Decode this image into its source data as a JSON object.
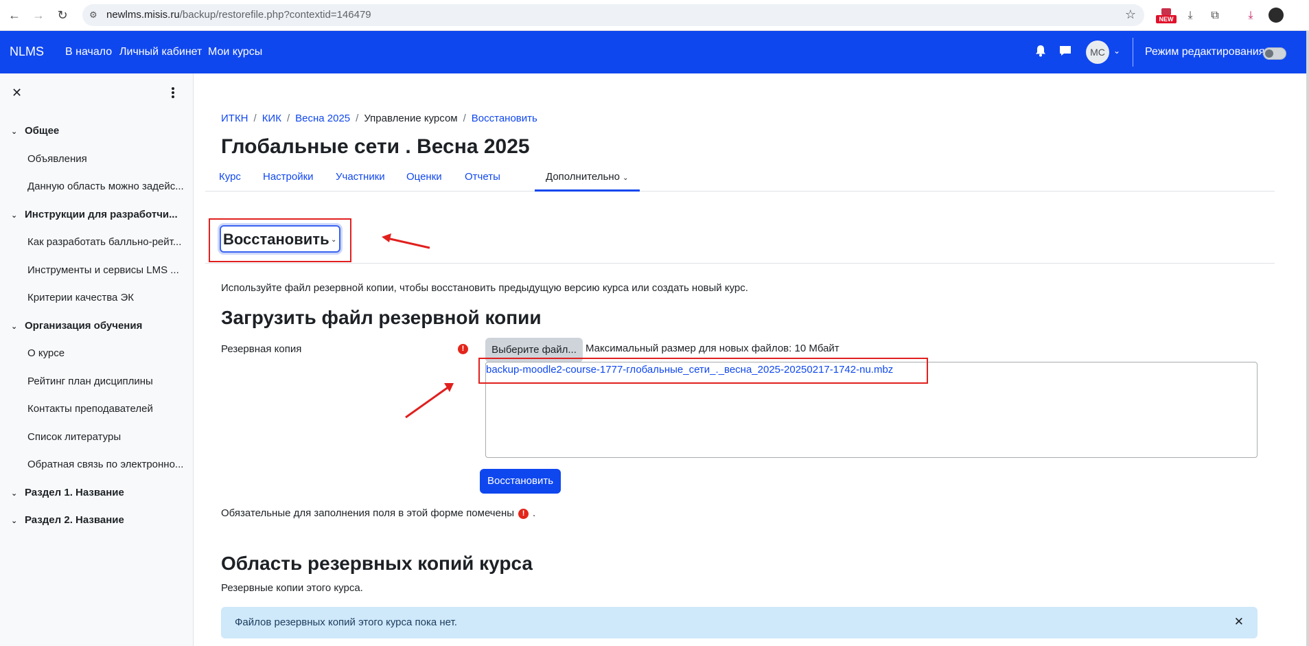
{
  "browser": {
    "url_host": "newlms.misis.ru",
    "url_path": "/backup/restorefile.php?contextid=146479",
    "new_badge": "NEW"
  },
  "navbar": {
    "brand": "NLMS",
    "links": [
      "В начало",
      "Личный кабинет",
      "Мои курсы"
    ],
    "avatar_initials": "МС",
    "edit_mode_label": "Режим редактирования"
  },
  "sidebar": {
    "sections": [
      {
        "title": "Общее",
        "items": [
          "Объявления",
          "Данную область можно задейс..."
        ]
      },
      {
        "title": "Инструкции для разработчи...",
        "items": [
          "Как разработать балльно-рейт...",
          "Инструменты и сервисы LMS ...",
          "Критерии качества ЭК"
        ]
      },
      {
        "title": "Организация обучения",
        "items": [
          "О курсе",
          "Рейтинг план дисциплины",
          "Контакты преподавателей",
          "Список литературы",
          "Обратная связь по электронно..."
        ]
      },
      {
        "title": "Раздел 1. Название",
        "items": []
      },
      {
        "title": "Раздел 2. Название",
        "items": []
      }
    ]
  },
  "breadcrumb": {
    "items": [
      "ИТКН",
      "КИК",
      "Весна 2025",
      "Управление курсом",
      "Восстановить"
    ]
  },
  "page": {
    "title": "Глобальные сети . Весна 2025",
    "tabs": [
      "Курс",
      "Настройки",
      "Участники",
      "Оценки",
      "Отчеты",
      "Дополнительно"
    ],
    "active_tab": "Дополнительно",
    "select_label": "Восстановить",
    "description": "Используйте файл резервной копии, чтобы восстановить предыдущую версию курса или создать новый курс.",
    "upload_heading": "Загрузить файл резервной копии",
    "field_label": "Резервная копия",
    "choose_file": "Выберите файл...",
    "max_size": "Максимальный размер для новых файлов: 10 Мбайт",
    "filename": "backup-moodle2-course-1777-глобальные_сети_._весна_2025-20250217-1742-nu.mbz",
    "restore_button": "Восстановить",
    "required_note": "Обязательные для заполнения поля в этой форме помечены",
    "required_note_end": ".",
    "area_heading": "Область резервных копий курса",
    "area_subtext": "Резервные копии этого курса.",
    "alert": "Файлов резервных копий этого курса пока нет."
  },
  "colors": {
    "brand_blue": "#0f47ef",
    "annotation_red": "#e0201e",
    "alert_bg": "#cfe8fa"
  }
}
